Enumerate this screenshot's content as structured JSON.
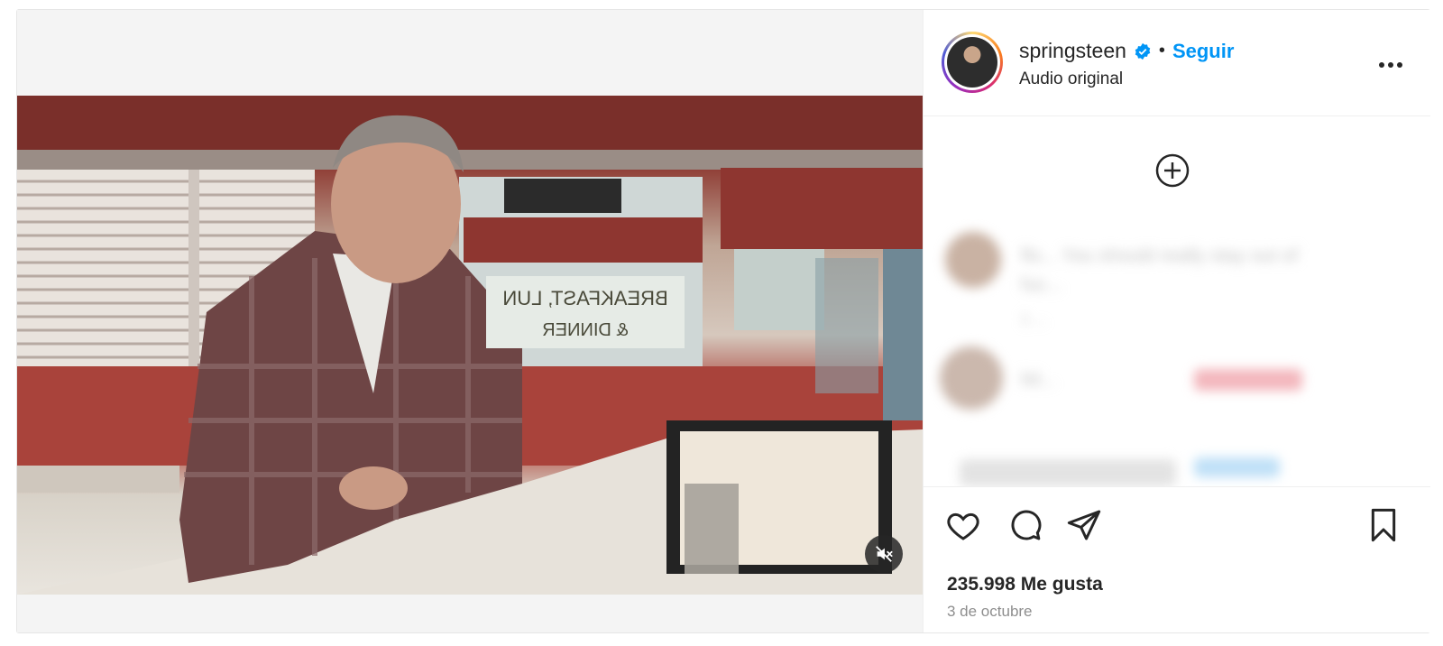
{
  "post": {
    "username": "springsteen",
    "follow_label": "Seguir",
    "separator": "•",
    "audio_label": "Audio original",
    "likes_text": "235.998 Me gusta",
    "date_text": "3 de octubre"
  },
  "comments": [
    {
      "text": "flo... You should really stay out of",
      "text2": "fuc...",
      "meta": "1 ..."
    },
    {
      "text": "lid..."
    },
    {
      "text": ""
    }
  ],
  "video": {
    "sign_line1": "BREAKFAST, LUN",
    "sign_line2": "& DINNER",
    "muted": true
  },
  "colors": {
    "accent": "#0095f6",
    "verified": "#0095f6",
    "text": "#262626",
    "muted_text": "#8e8e8e"
  },
  "icons": [
    "verified-badge-icon",
    "more-options-icon",
    "add-comment-icon",
    "heart-icon",
    "comment-icon",
    "share-icon",
    "bookmark-icon",
    "mute-icon"
  ]
}
